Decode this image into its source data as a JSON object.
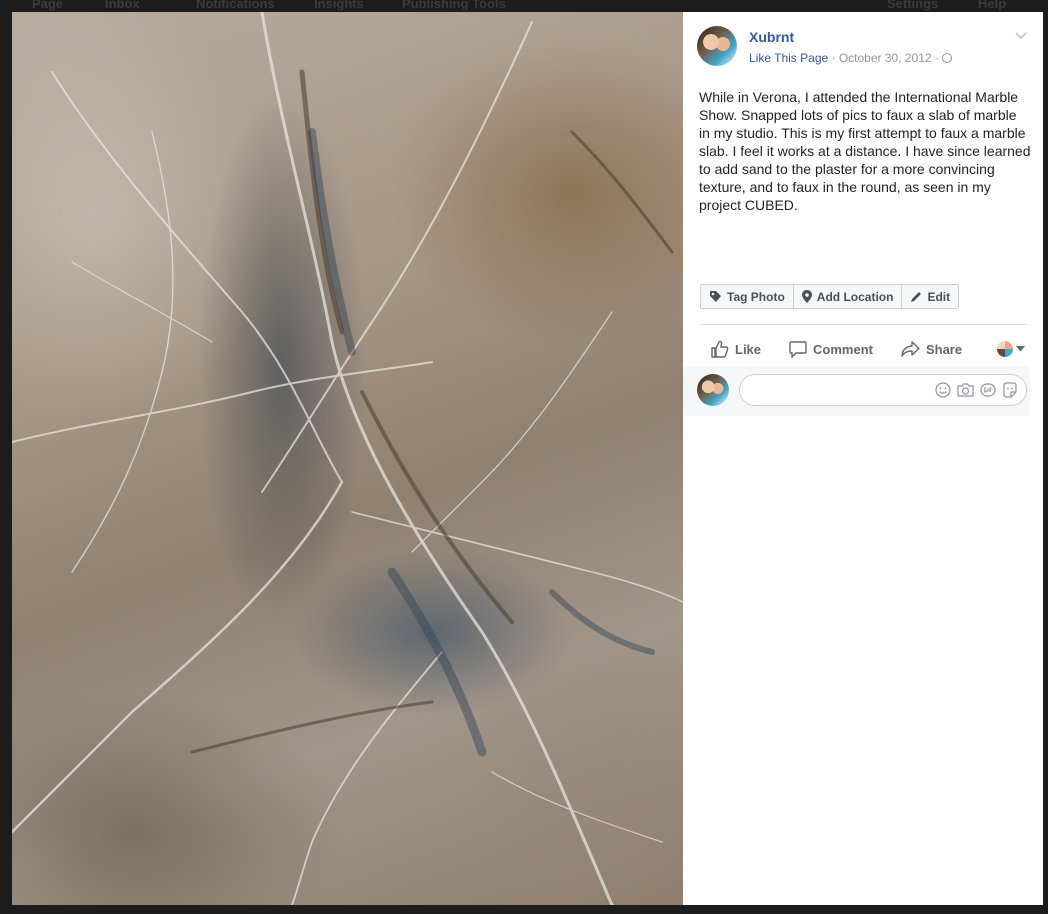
{
  "background_nav": {
    "items": [
      "Page",
      "Inbox",
      "Notifications",
      "Insights",
      "Publishing Tools",
      "Settings",
      "Help"
    ]
  },
  "post": {
    "page_name": "Xubrnt",
    "like_page_label": "Like This Page",
    "separator": " · ",
    "date": "October 30, 2012",
    "text": "While in Verona, I attended the International Marble Show. Snapped lots of pics to faux a slab of marble in my studio. This is my first attempt to faux a marble slab. I feel it works at a distance. I have since learned to add sand to the plaster for a more convincing texture, and to faux in the round, as seen in my project CUBED."
  },
  "photo_tools": {
    "tag_photo": "Tag Photo",
    "add_location": "Add Location",
    "edit": "Edit"
  },
  "actions": {
    "like": "Like",
    "comment": "Comment",
    "share": "Share"
  },
  "comment_box": {
    "placeholder": ""
  },
  "colors": {
    "link": "#365899",
    "meta": "#90949c",
    "text": "#1d2129",
    "action": "#606770"
  }
}
